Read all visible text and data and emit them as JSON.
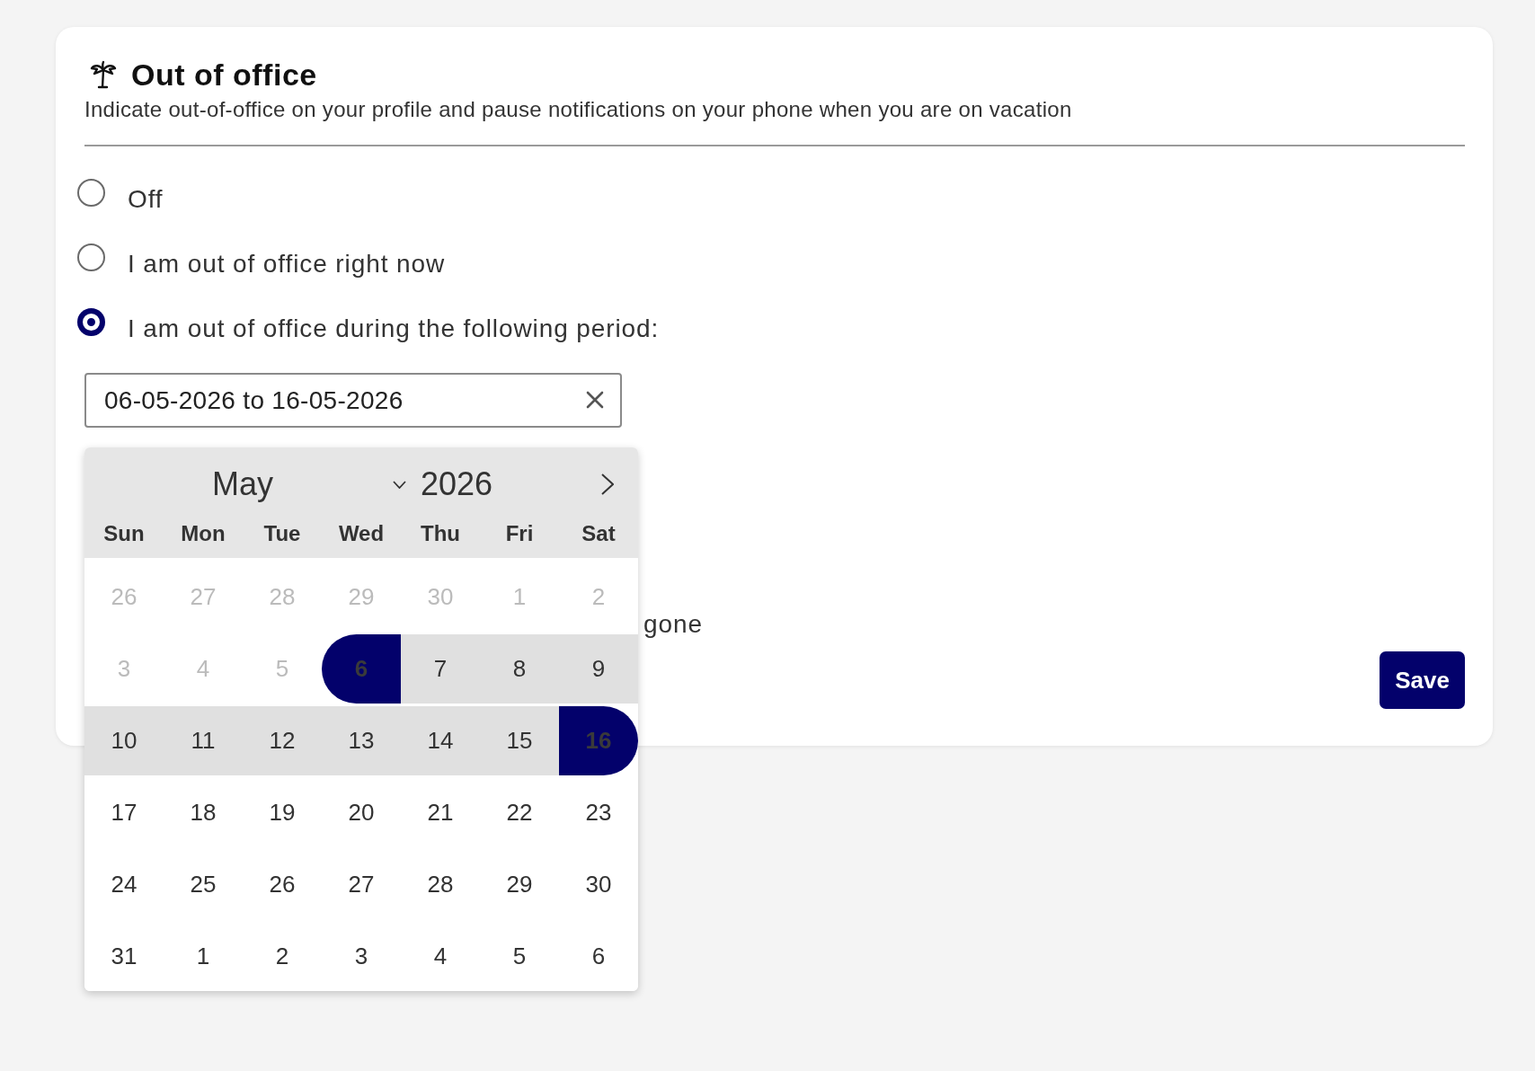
{
  "header": {
    "title": "Out of office",
    "subtitle": "Indicate out-of-office on your profile and pause notifications on your phone when you are on vacation"
  },
  "options": [
    {
      "label": "Off",
      "selected": false
    },
    {
      "label": "I am out of office right now",
      "selected": false
    },
    {
      "label": "I am out of office during the following period:",
      "selected": true
    }
  ],
  "date_range_field": {
    "value": "06-05-2026 to 16-05-2026"
  },
  "covered_label": "gone",
  "save_button": "Save",
  "date_picker": {
    "month": "May",
    "year": "2026",
    "weekdays": [
      "Sun",
      "Mon",
      "Tue",
      "Wed",
      "Thu",
      "Fri",
      "Sat"
    ],
    "days": [
      {
        "label": "26",
        "disabled": true,
        "selected": false,
        "in_range": false
      },
      {
        "label": "27",
        "disabled": true,
        "selected": false,
        "in_range": false
      },
      {
        "label": "28",
        "disabled": true,
        "selected": false,
        "in_range": false
      },
      {
        "label": "29",
        "disabled": true,
        "selected": false,
        "in_range": false
      },
      {
        "label": "30",
        "disabled": true,
        "selected": false,
        "in_range": false
      },
      {
        "label": "1",
        "disabled": true,
        "selected": false,
        "in_range": false
      },
      {
        "label": "2",
        "disabled": true,
        "selected": false,
        "in_range": false
      },
      {
        "label": "3",
        "disabled": true,
        "selected": false,
        "in_range": false
      },
      {
        "label": "4",
        "disabled": true,
        "selected": false,
        "in_range": false
      },
      {
        "label": "5",
        "disabled": true,
        "selected": false,
        "in_range": false
      },
      {
        "label": "6",
        "disabled": false,
        "selected": true,
        "in_range": false
      },
      {
        "label": "7",
        "disabled": false,
        "selected": false,
        "in_range": true
      },
      {
        "label": "8",
        "disabled": false,
        "selected": false,
        "in_range": true
      },
      {
        "label": "9",
        "disabled": false,
        "selected": false,
        "in_range": true
      },
      {
        "label": "10",
        "disabled": false,
        "selected": false,
        "in_range": true
      },
      {
        "label": "11",
        "disabled": false,
        "selected": false,
        "in_range": true
      },
      {
        "label": "12",
        "disabled": false,
        "selected": false,
        "in_range": true
      },
      {
        "label": "13",
        "disabled": false,
        "selected": false,
        "in_range": true
      },
      {
        "label": "14",
        "disabled": false,
        "selected": false,
        "in_range": true
      },
      {
        "label": "15",
        "disabled": false,
        "selected": false,
        "in_range": true
      },
      {
        "label": "16",
        "disabled": false,
        "selected": true,
        "in_range": false
      },
      {
        "label": "17",
        "disabled": false,
        "selected": false,
        "in_range": false
      },
      {
        "label": "18",
        "disabled": false,
        "selected": false,
        "in_range": false
      },
      {
        "label": "19",
        "disabled": false,
        "selected": false,
        "in_range": false
      },
      {
        "label": "20",
        "disabled": false,
        "selected": false,
        "in_range": false
      },
      {
        "label": "21",
        "disabled": false,
        "selected": false,
        "in_range": false
      },
      {
        "label": "22",
        "disabled": false,
        "selected": false,
        "in_range": false
      },
      {
        "label": "23",
        "disabled": false,
        "selected": false,
        "in_range": false
      },
      {
        "label": "24",
        "disabled": false,
        "selected": false,
        "in_range": false
      },
      {
        "label": "25",
        "disabled": false,
        "selected": false,
        "in_range": false
      },
      {
        "label": "26",
        "disabled": false,
        "selected": false,
        "in_range": false
      },
      {
        "label": "27",
        "disabled": false,
        "selected": false,
        "in_range": false
      },
      {
        "label": "28",
        "disabled": false,
        "selected": false,
        "in_range": false
      },
      {
        "label": "29",
        "disabled": false,
        "selected": false,
        "in_range": false
      },
      {
        "label": "30",
        "disabled": false,
        "selected": false,
        "in_range": false
      },
      {
        "label": "31",
        "disabled": false,
        "selected": false,
        "in_range": false
      },
      {
        "label": "1",
        "disabled": false,
        "selected": false,
        "in_range": false
      },
      {
        "label": "2",
        "disabled": false,
        "selected": false,
        "in_range": false
      },
      {
        "label": "3",
        "disabled": false,
        "selected": false,
        "in_range": false
      },
      {
        "label": "4",
        "disabled": false,
        "selected": false,
        "in_range": false
      },
      {
        "label": "5",
        "disabled": false,
        "selected": false,
        "in_range": false
      },
      {
        "label": "6",
        "disabled": false,
        "selected": false,
        "in_range": false
      }
    ]
  }
}
